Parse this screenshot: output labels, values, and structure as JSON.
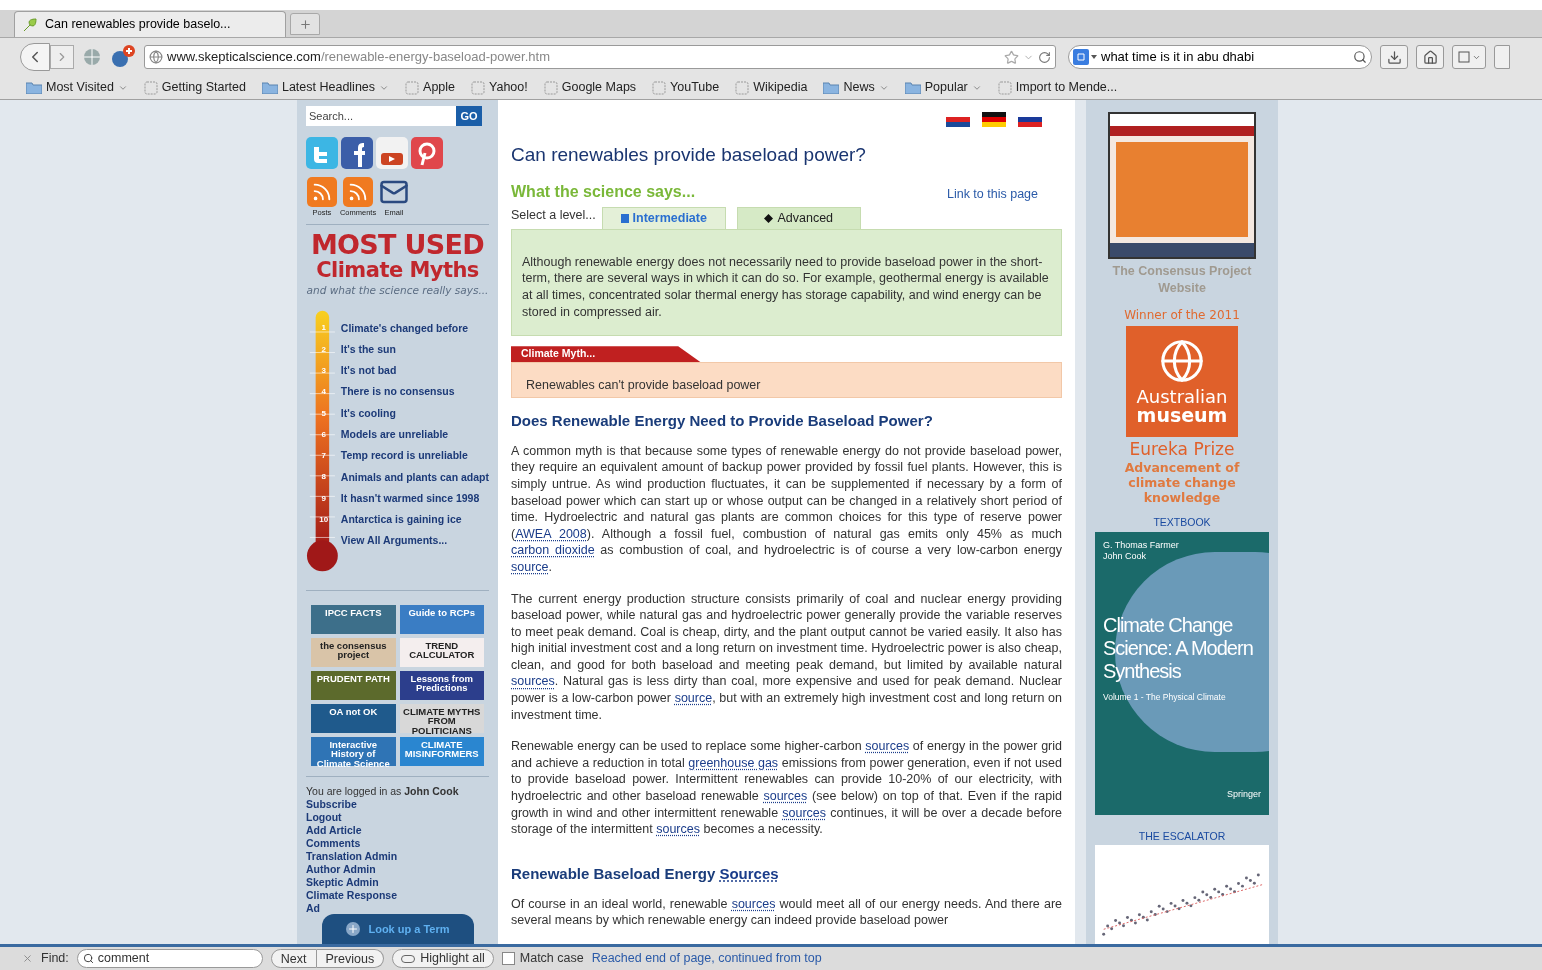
{
  "browser": {
    "tab": {
      "title": "Can renewables provide baselo..."
    },
    "url": {
      "host": "www.skepticalscience.com",
      "path": "/renewable-energy-baseload-power.htm"
    },
    "search": {
      "value": "what time is it in abu dhabi"
    },
    "bookmarks": [
      {
        "label": "Most Visited",
        "kind": "menu"
      },
      {
        "label": "Getting Started",
        "kind": "page"
      },
      {
        "label": "Latest Headlines",
        "kind": "menu"
      },
      {
        "label": "Apple",
        "kind": "page"
      },
      {
        "label": "Yahoo!",
        "kind": "page"
      },
      {
        "label": "Google Maps",
        "kind": "page"
      },
      {
        "label": "YouTube",
        "kind": "page"
      },
      {
        "label": "Wikipedia",
        "kind": "page"
      },
      {
        "label": "News",
        "kind": "menu"
      },
      {
        "label": "Popular",
        "kind": "menu"
      },
      {
        "label": "Import to Mende...",
        "kind": "page"
      }
    ]
  },
  "left_sidebar": {
    "search": {
      "placeholder": "Search...",
      "button": "GO"
    },
    "feeds": [
      "Posts",
      "Comments",
      "Email"
    ],
    "myths_header": {
      "line_1": "MOST USED",
      "line_2": "Climate Myths",
      "tagline": "and what the science really says..."
    },
    "myths": [
      {
        "number": "1",
        "label": "Climate's changed before"
      },
      {
        "number": "2",
        "label": "It's the sun"
      },
      {
        "number": "3",
        "label": "It's not bad"
      },
      {
        "number": "4",
        "label": "There is no consensus"
      },
      {
        "number": "5",
        "label": "It's cooling"
      },
      {
        "number": "6",
        "label": "Models are unreliable"
      },
      {
        "number": "7",
        "label": "Temp record is unreliable"
      },
      {
        "number": "8",
        "label": "Animals and plants can adapt"
      },
      {
        "number": "9",
        "label": "It hasn't warmed since 1998"
      },
      {
        "number": "10",
        "label": "Antarctica is gaining ice"
      },
      {
        "label": "View All Arguments..."
      }
    ],
    "banners": [
      {
        "label": "IPCC FACTS",
        "color": "#3d6f8a"
      },
      {
        "label": "Guide to RCPs",
        "color": "#3a7dc4"
      },
      {
        "label": "the consensus project",
        "color": "#d9c4a8"
      },
      {
        "label": "TREND CALCULATOR",
        "color": "#f4eeee"
      },
      {
        "label": "PRUDENT PATH",
        "color": "#5c6a2c"
      },
      {
        "label": "Lessons from Predictions",
        "color": "#2c3e8c"
      },
      {
        "label": "OA not OK",
        "color": "#1f5a8c"
      },
      {
        "label": "CLIMATE MYTHS FROM POLITICIANS",
        "color": "#d8d8d8"
      },
      {
        "label": "Interactive History of Climate Science",
        "color": "#2f74b5"
      },
      {
        "label": "CLIMATE MISINFORMERS",
        "color": "#2a86d0"
      }
    ],
    "login": "You are logged in as **John Cook**",
    "admin_links": [
      "Subscribe",
      "Logout",
      "Add Article",
      "Comments",
      "Translation Admin",
      "Author Admin",
      "Skeptic Admin",
      "Climate Response",
      "Ad"
    ],
    "lookup_button": "Look up a Term"
  },
  "main": {
    "title": "Can renewables provide baseload power?",
    "science_heading": "What the science says...",
    "link_to_page": "Link to this page",
    "level_label": "Select a level...",
    "levels": [
      {
        "label": "Intermediate",
        "selected": true
      },
      {
        "label": "Advanced",
        "selected": false
      }
    ],
    "summary": "Although renewable energy does not necessarily need to provide baseload power in the short-term, there are several ways in which it can do so. For example, geothermal energy is available at all times, concentrated solar thermal energy has storage capability, and wind energy can be stored in compressed air.",
    "myth_label": "Climate Myth...",
    "myth": "Renewables can't provide baseload power",
    "blocks": [
      {
        "kind": "heading",
        "parts": [
          {
            "text": "Does Renewable Energy Need to Provide Baseload Power?"
          }
        ]
      },
      {
        "kind": "paragraph",
        "parts": [
          {
            "text": "A common myth is that because some types of renewable energy do not provide baseload power, they require an equivalent amount of backup power provided by fossil fuel plants. However, this is simply untrue. As wind production fluctuates, it can be supplemented if necessary by a form of baseload power which can start up or whose output can be changed in a relatively short period of time. Hydroelectric and natural gas plants are common choices for this type of reserve power ("
          },
          {
            "text": "AWEA 2008",
            "link": true
          },
          {
            "text": "). Although a fossil fuel, combustion of natural gas emits only 45% as much "
          },
          {
            "text": "carbon dioxide",
            "link": true
          },
          {
            "text": " as combustion of coal, and hydroelectric is of course a very low-carbon energy "
          },
          {
            "text": "source",
            "link": true
          },
          {
            "text": "."
          }
        ]
      },
      {
        "kind": "paragraph",
        "parts": [
          {
            "text": "The current energy production structure consists primarily of coal and nuclear energy providing baseload power, while natural gas and hydroelectric power generally provide the variable reserves to meet peak demand. Coal is cheap, dirty, and the plant output cannot be varied easily. It also has high initial investment cost and a long return on investment time. Hydroelectric power is also cheap, clean, and good for both baseload and meeting peak demand, but limited by available natural "
          },
          {
            "text": "sources",
            "link": true
          },
          {
            "text": ". Natural gas is less dirty than coal, more expensive and used for peak demand. Nuclear power is a low-carbon power "
          },
          {
            "text": "source",
            "link": true
          },
          {
            "text": ", but with an extremely high investment cost and long return on investment time."
          }
        ]
      },
      {
        "kind": "paragraph",
        "parts": [
          {
            "text": "Renewable energy can be used to replace some higher-carbon "
          },
          {
            "text": "sources",
            "link": true
          },
          {
            "text": " of energy in the power grid and achieve a reduction in total "
          },
          {
            "text": "greenhouse gas",
            "link": true
          },
          {
            "text": " emissions from power generation, even if not used to provide baseload power. Intermittent renewables can provide 10-20% of our electricity, with hydroelectric and other baseload renewable "
          },
          {
            "text": "sources",
            "link": true
          },
          {
            "text": " (see below) on top of that. Even if the rapid growth in wind and other intermittent renewable "
          },
          {
            "text": "sources",
            "link": true
          },
          {
            "text": " continues, it will be over a decade before storage of the intermittent "
          },
          {
            "text": "sources",
            "link": true
          },
          {
            "text": " becomes a necessity."
          }
        ]
      },
      {
        "kind": "heading",
        "parts": [
          {
            "text": "Renewable Baseload Energy "
          },
          {
            "text": "Sources",
            "link": true
          }
        ]
      },
      {
        "kind": "paragraph",
        "parts": [
          {
            "text": "Of course in an ideal world, renewable "
          },
          {
            "text": "sources",
            "link": true
          },
          {
            "text": " would meet all of our energy needs. And there are several means by which renewable energy can indeed provide baseload power"
          }
        ]
      }
    ]
  },
  "right_sidebar": {
    "consensus_caption": "The Consensus Project Website",
    "award_intro": "Winner of the 2011",
    "museum_logo": {
      "line_1": "Australian",
      "line_2": "museum"
    },
    "award_name": "Eureka Prize",
    "award_detail": "Advancement of climate change knowledge",
    "textbook_label": "TEXTBOOK",
    "book": {
      "authors": [
        "G. Thomas Farmer",
        "John Cook"
      ],
      "title": "Climate Change Science: A Modern Synthesis",
      "volume": "Volume 1 - The Physical Climate",
      "publisher": "Springer"
    },
    "escalator_label": "THE ESCALATOR"
  },
  "find_bar": {
    "label": "Find:",
    "value": "comment",
    "buttons": [
      "Next",
      "Previous"
    ],
    "highlight": "Highlight all",
    "match_case": {
      "label": "Match case",
      "checked": false
    },
    "status": "Reached end of page, continued from top"
  }
}
